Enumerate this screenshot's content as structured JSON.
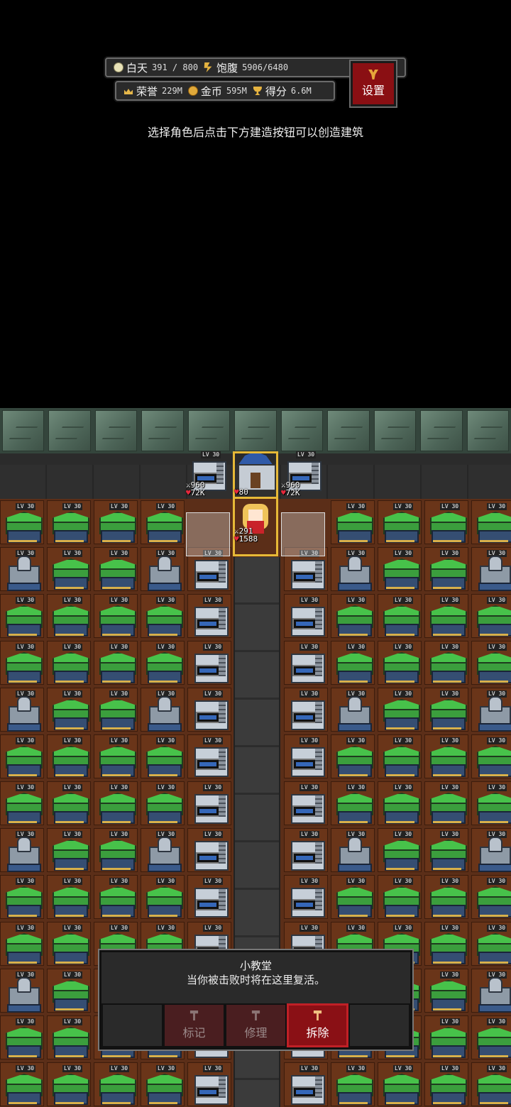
{
  "hud": {
    "day_label": "白天",
    "day_value": "391 / 800",
    "food_label": "饱腹",
    "food_value": "5906/6480",
    "honor_label": "荣誉",
    "honor_value": "229M",
    "gold_label": "金币",
    "gold_value": "595M",
    "score_label": "得分",
    "score_value": "6.6M",
    "settings_label": "设置"
  },
  "hint": "选择角色后点击下方建造按钮可以创造建筑",
  "building_level": "LV 30",
  "units": {
    "left_tower": {
      "atk": "960",
      "hp": "72K"
    },
    "church": {
      "hp": "80"
    },
    "right_tower": {
      "atk": "960",
      "hp": "72K"
    },
    "hero": {
      "atk": "291",
      "hp": "1588"
    }
  },
  "panel": {
    "title": "小教堂",
    "description": "当你被击败时将在这里复活。",
    "buttons": {
      "mark": "标记",
      "repair": "修理",
      "demolish": "拆除"
    }
  },
  "colors": {
    "accent_red": "#8a1015",
    "selection_gold": "#e7b937",
    "farm_green": "#47c24a"
  }
}
